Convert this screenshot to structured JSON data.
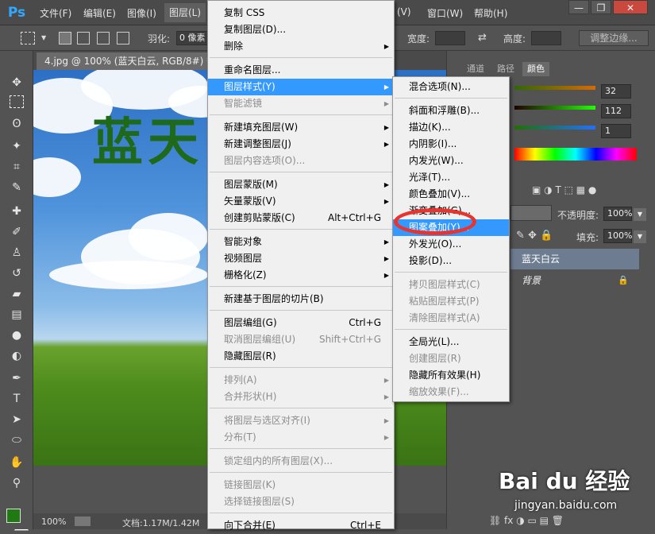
{
  "menubar": {
    "logo": "Ps",
    "items": [
      "文件(F)",
      "编辑(E)",
      "图像(I)",
      "图层(L)",
      "(V)",
      "窗口(W)",
      "帮助(H)"
    ],
    "window_buttons": [
      "—",
      "❐",
      "✕"
    ]
  },
  "options": {
    "feather_label": "羽化:",
    "feather_value": "0 像素",
    "width_label": "宽度:",
    "height_label": "高度:",
    "refine_label": "调整边缘..."
  },
  "document": {
    "tab_title": "4.jpg @ 100% (蓝天白云, RGB/8#) *",
    "canvas_text": "蓝天",
    "zoom": "100%",
    "doc_info": "文档:1.17M/1.42M"
  },
  "right_panel": {
    "tabs": [
      "通道",
      "路径",
      "颜色"
    ],
    "color_values": [
      "32",
      "112",
      "1"
    ],
    "opacity_label": "不透明度:",
    "opacity_value": "100%",
    "fill_label": "填充:",
    "fill_value": "100%",
    "layers": [
      "蓝天白云",
      "背景"
    ]
  },
  "layer_menu": {
    "items": [
      {
        "label": "复制 CSS",
        "shortcut": "",
        "submenu": false,
        "disabled": false
      },
      {
        "label": "复制图层(D)...",
        "shortcut": "",
        "submenu": false,
        "disabled": false
      },
      {
        "label": "删除",
        "shortcut": "",
        "submenu": true,
        "disabled": false
      },
      {
        "label": "重命名图层...",
        "shortcut": "",
        "submenu": false,
        "disabled": false
      },
      {
        "label": "图层样式(Y)",
        "shortcut": "",
        "submenu": true,
        "disabled": false,
        "highlighted": true
      },
      {
        "label": "智能滤镜",
        "shortcut": "",
        "submenu": true,
        "disabled": true
      },
      {
        "label": "新建填充图层(W)",
        "shortcut": "",
        "submenu": true,
        "disabled": false
      },
      {
        "label": "新建调整图层(J)",
        "shortcut": "",
        "submenu": true,
        "disabled": false
      },
      {
        "label": "图层内容选项(O)...",
        "shortcut": "",
        "submenu": false,
        "disabled": true
      },
      {
        "label": "图层蒙版(M)",
        "shortcut": "",
        "submenu": true,
        "disabled": false
      },
      {
        "label": "矢量蒙版(V)",
        "shortcut": "",
        "submenu": true,
        "disabled": false
      },
      {
        "label": "创建剪贴蒙版(C)",
        "shortcut": "Alt+Ctrl+G",
        "submenu": false,
        "disabled": false
      },
      {
        "label": "智能对象",
        "shortcut": "",
        "submenu": true,
        "disabled": false
      },
      {
        "label": "视频图层",
        "shortcut": "",
        "submenu": true,
        "disabled": false
      },
      {
        "label": "栅格化(Z)",
        "shortcut": "",
        "submenu": true,
        "disabled": false
      },
      {
        "label": "新建基于图层的切片(B)",
        "shortcut": "",
        "submenu": false,
        "disabled": false
      },
      {
        "label": "图层编组(G)",
        "shortcut": "Ctrl+G",
        "submenu": false,
        "disabled": false
      },
      {
        "label": "取消图层编组(U)",
        "shortcut": "Shift+Ctrl+G",
        "submenu": false,
        "disabled": true
      },
      {
        "label": "隐藏图层(R)",
        "shortcut": "",
        "submenu": false,
        "disabled": false
      },
      {
        "label": "排列(A)",
        "shortcut": "",
        "submenu": true,
        "disabled": true
      },
      {
        "label": "合并形状(H)",
        "shortcut": "",
        "submenu": true,
        "disabled": true
      },
      {
        "label": "将图层与选区对齐(I)",
        "shortcut": "",
        "submenu": true,
        "disabled": true
      },
      {
        "label": "分布(T)",
        "shortcut": "",
        "submenu": true,
        "disabled": true
      },
      {
        "label": "锁定组内的所有图层(X)...",
        "shortcut": "",
        "submenu": false,
        "disabled": true
      },
      {
        "label": "链接图层(K)",
        "shortcut": "",
        "submenu": false,
        "disabled": true
      },
      {
        "label": "选择链接图层(S)",
        "shortcut": "",
        "submenu": false,
        "disabled": true
      },
      {
        "label": "向下合并(E)",
        "shortcut": "Ctrl+E",
        "submenu": false,
        "disabled": false
      }
    ]
  },
  "style_submenu": {
    "items": [
      {
        "label": "混合选项(N)...",
        "disabled": false
      },
      {
        "label": "斜面和浮雕(B)...",
        "disabled": false
      },
      {
        "label": "描边(K)...",
        "disabled": false
      },
      {
        "label": "内阴影(I)...",
        "disabled": false
      },
      {
        "label": "内发光(W)...",
        "disabled": false
      },
      {
        "label": "光泽(T)...",
        "disabled": false
      },
      {
        "label": "颜色叠加(V)...",
        "disabled": false
      },
      {
        "label": "渐变叠加(G)...",
        "disabled": false
      },
      {
        "label": "图案叠加(Y)...",
        "disabled": false,
        "highlighted": true
      },
      {
        "label": "外发光(O)...",
        "disabled": false
      },
      {
        "label": "投影(D)...",
        "disabled": false
      },
      {
        "label": "拷贝图层样式(C)",
        "disabled": true
      },
      {
        "label": "粘贴图层样式(P)",
        "disabled": true
      },
      {
        "label": "清除图层样式(A)",
        "disabled": true
      },
      {
        "label": "全局光(L)...",
        "disabled": false
      },
      {
        "label": "创建图层(R)",
        "disabled": true
      },
      {
        "label": "隐藏所有效果(H)",
        "disabled": false
      },
      {
        "label": "缩放效果(F)...",
        "disabled": true
      }
    ]
  },
  "watermark": {
    "brand": "Bai du 经验",
    "url": "jingyan.baidu.com"
  },
  "colors": {
    "menu_highlight": "#3399ff",
    "ring": "#e8342f",
    "foreground_swatch": "#1f7a12"
  }
}
